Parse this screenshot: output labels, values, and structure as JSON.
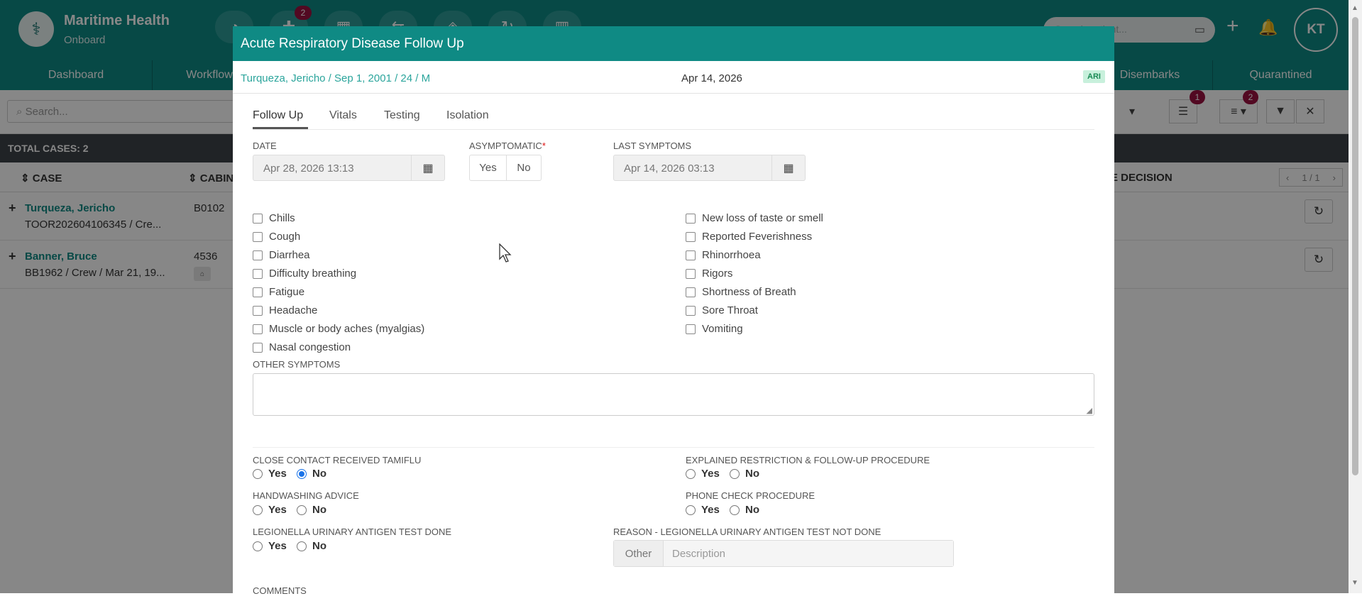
{
  "app": {
    "brand_title": "Maritime Health",
    "brand_subtitle": "Onboard",
    "badge_count": "2",
    "search_placeholder": "Search patient...",
    "avatar_initials": "KT"
  },
  "nav": {
    "items": [
      "Dashboard",
      "Workflow",
      "Disembarks",
      "Quarantined"
    ]
  },
  "list": {
    "search_placeholder": "Search...",
    "filter_badge": "1",
    "columns_badge": "2",
    "total_cases": "TOTAL CASES: 2",
    "col_case": "CASE",
    "col_cabin": "CABIN",
    "col_decision": "E DECISION",
    "pager": "1 / 1",
    "rows": [
      {
        "name": "Turqueza, Jericho",
        "sub": "TOOR202604106345 / Cre...",
        "cabin": "B0102"
      },
      {
        "name": "Banner, Bruce",
        "sub": "BB1962 / Crew / Mar 21, 19...",
        "cabin": "4536"
      }
    ]
  },
  "modal": {
    "title": "Acute Respiratory Disease Follow Up",
    "patient": "Turqueza, Jericho / Sep 1, 2001 / 24 / M",
    "date": "Apr 14, 2026",
    "tag": "ARI",
    "tabs": [
      "Follow Up",
      "Vitals",
      "Testing",
      "Isolation"
    ],
    "date_label": "DATE",
    "date_value": "Apr 28, 2026 13:13",
    "asymptomatic_label": "ASYMPTOMATIC",
    "yes": "Yes",
    "no": "No",
    "last_symptoms_label": "LAST SYMPTOMS",
    "last_symptoms_value": "Apr 14, 2026 03:13",
    "symptoms_left": [
      "Chills",
      "Cough",
      "Diarrhea",
      "Difficulty breathing",
      "Fatigue",
      "Headache",
      "Muscle or body aches (myalgias)",
      "Nasal congestion"
    ],
    "symptoms_right": [
      "New loss of taste or smell",
      "Reported Feverishness",
      "Rhinorrhoea",
      "Rigors",
      "Shortness of Breath",
      "Sore Throat",
      "Vomiting"
    ],
    "other_symptoms_label": "OTHER SYMPTOMS",
    "q_tamiflu": "CLOSE CONTACT RECEIVED TAMIFLU",
    "q_restriction": "EXPLAINED RESTRICTION & FOLLOW-UP PROCEDURE",
    "q_handwashing": "HANDWASHING ADVICE",
    "q_phone": "PHONE CHECK PROCEDURE",
    "q_legionella": "LEGIONELLA URINARY ANTIGEN TEST DONE",
    "q_reason": "REASON - LEGIONELLA URINARY ANTIGEN TEST NOT DONE",
    "reason_prefix": "Other",
    "reason_placeholder": "Description",
    "comments_label": "COMMENTS"
  }
}
